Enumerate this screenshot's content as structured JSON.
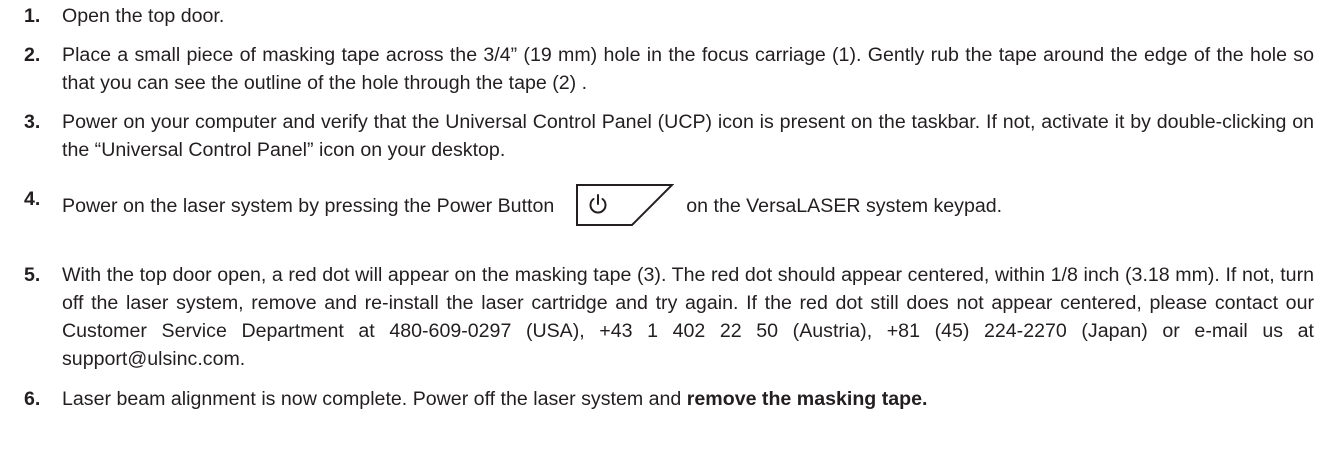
{
  "steps": [
    {
      "number": "1.",
      "text": "Open the top door."
    },
    {
      "number": "2.",
      "text": "Place a small piece of masking tape across the 3/4” (19 mm) hole in the focus carriage (1). Gently rub the tape around the edge of the hole so that you can see the outline of the hole through the tape (2) ."
    },
    {
      "number": "3.",
      "text": "Power on your computer and verify that the Universal Control Panel (UCP) icon is present on the taskbar. If not, activate it by double-clicking on the “Universal Control Panel” icon on your desktop."
    },
    {
      "number": "4.",
      "text_before": "Power on the laser system by pressing the Power Button",
      "text_after": "on the VersaLASER system keypad.",
      "icon": "power-button-icon"
    },
    {
      "number": "5.",
      "text": "With the top door open, a red dot will appear on the masking tape (3). The red dot should appear centered, within 1/8 inch (3.18 mm). If not, turn off the laser system, remove and re-install the laser cartridge and try again. If the red dot still does not appear centered, please contact our Customer Service Department at 480-609-0297 (USA), +43 1 402 22 50 (Austria), +81 (45) 224-2270 (Japan) or e-mail us at support@ulsinc.com."
    },
    {
      "number": "6.",
      "text_before": "Laser beam alignment is now complete. Power off the laser system and",
      "text_bold": "remove the masking tape."
    }
  ]
}
